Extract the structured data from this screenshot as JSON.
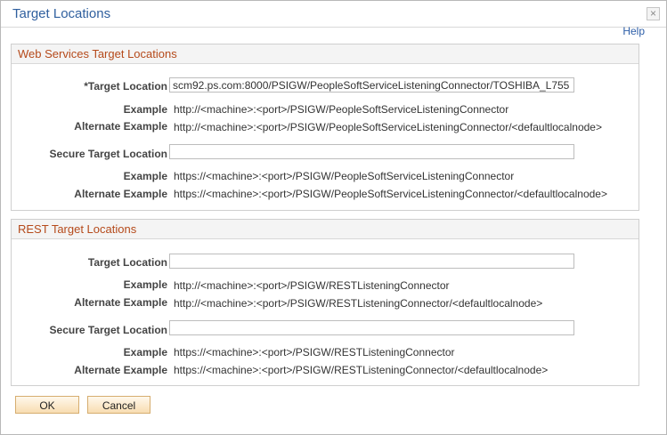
{
  "window": {
    "title": "Target Locations",
    "help_label": "Help"
  },
  "web_services": {
    "header": "Web Services Target Locations",
    "target_location_label": "*Target Location",
    "target_location_value": "scm92.ps.com:8000/PSIGW/PeopleSoftServiceListeningConnector/TOSHIBA_L755",
    "example_label": "Example",
    "example_value": "http://<machine>:<port>/PSIGW/PeopleSoftServiceListeningConnector",
    "alt_example_label": "Alternate Example",
    "alt_example_value": "http://<machine>:<port>/PSIGW/PeopleSoftServiceListeningConnector/<defaultlocalnode>",
    "secure_target_label": "Secure Target Location",
    "secure_target_value": "",
    "secure_example_label": "Example",
    "secure_example_value": "https://<machine>:<port>/PSIGW/PeopleSoftServiceListeningConnector",
    "secure_alt_example_label": "Alternate Example",
    "secure_alt_example_value": "https://<machine>:<port>/PSIGW/PeopleSoftServiceListeningConnector/<defaultlocalnode>"
  },
  "rest": {
    "header": "REST Target Locations",
    "target_location_label": "Target Location",
    "target_location_value": "",
    "example_label": "Example",
    "example_value": "http://<machine>:<port>/PSIGW/RESTListeningConnector",
    "alt_example_label": "Alternate Example",
    "alt_example_value": "http://<machine>:<port>/PSIGW/RESTListeningConnector/<defaultlocalnode>",
    "secure_target_label": "Secure Target Location",
    "secure_target_value": "",
    "secure_example_label": "Example",
    "secure_example_value": "https://<machine>:<port>/PSIGW/RESTListeningConnector",
    "secure_alt_example_label": "Alternate Example",
    "secure_alt_example_value": "https://<machine>:<port>/PSIGW/RESTListeningConnector/<defaultlocalnode>"
  },
  "buttons": {
    "ok": "OK",
    "cancel": "Cancel"
  },
  "icons": {
    "close": "close-icon"
  }
}
